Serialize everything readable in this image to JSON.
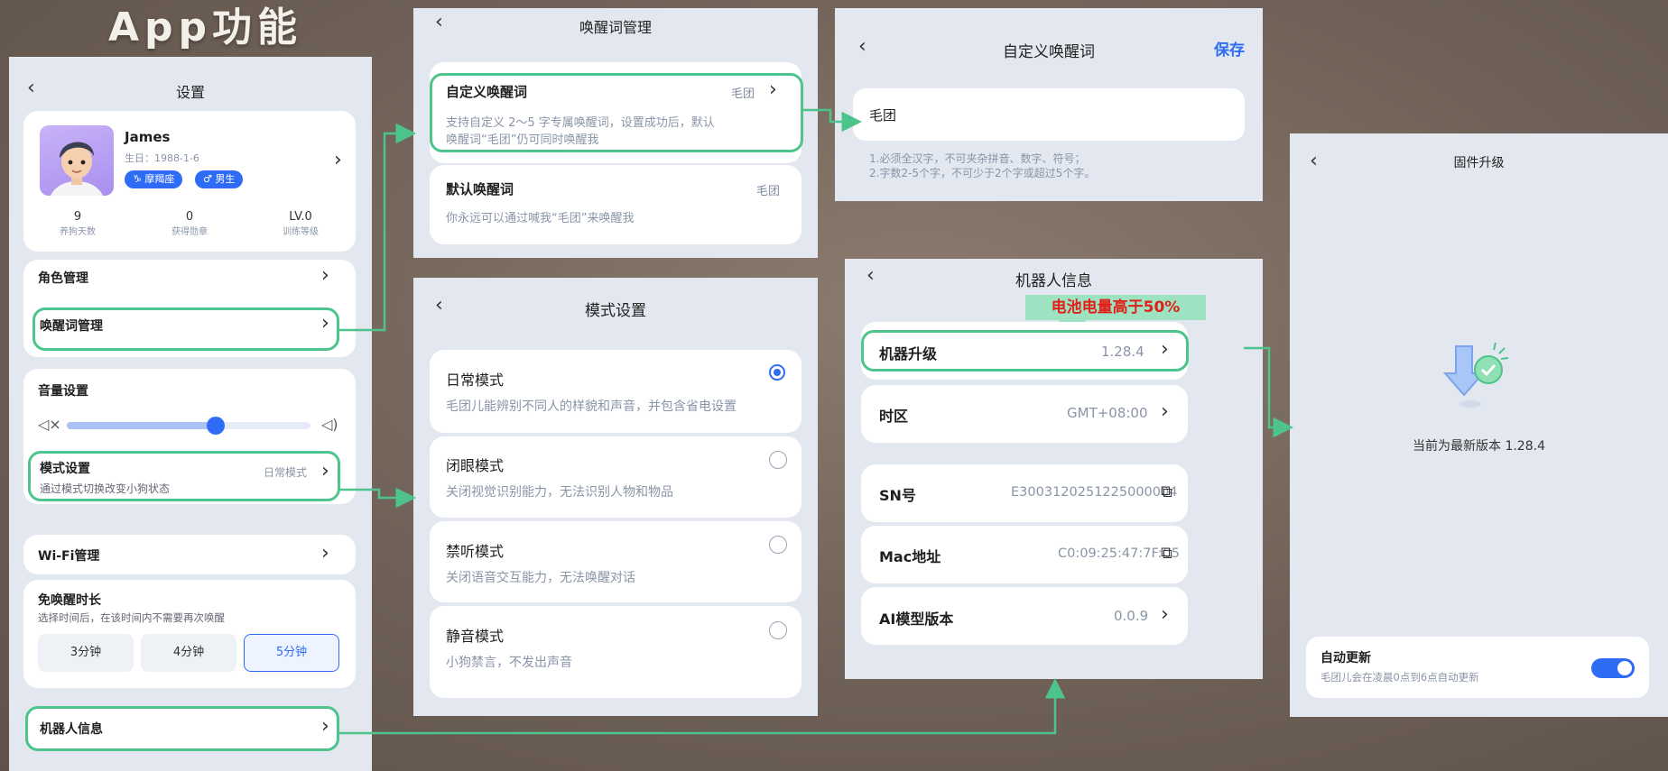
{
  "page_title": "App功能",
  "settings": {
    "title": "设置",
    "profile": {
      "name": "James",
      "birthday": "生日：1988-1-6",
      "zodiac": "摩羯座",
      "gender": "男生",
      "stats": [
        {
          "value": "9",
          "label": "养狗天数"
        },
        {
          "value": "0",
          "label": "获得勋章"
        },
        {
          "value": "LV.0",
          "label": "训练等级"
        }
      ]
    },
    "role": "角色管理",
    "wake_word": "唤醒词管理",
    "volume": "音量设置",
    "volume_level": 0.61,
    "mode": {
      "title": "模式设置",
      "value": "日常模式",
      "desc": "通过模式切换改变小狗状态"
    },
    "wifi": "Wi-Fi管理",
    "nowake": {
      "title": "免唤醒时长",
      "desc": "选择时间后，在该时间内不需要再次唤醒",
      "options": [
        "3分钟",
        "4分钟",
        "5分钟"
      ],
      "selected": "5分钟"
    },
    "robot_info": "机器人信息"
  },
  "wake_panel": {
    "title": "唤醒词管理",
    "custom": {
      "title": "自定义唤醒词",
      "value": "毛团",
      "desc1": "支持自定义 2～5 字专属唤醒词，设置成功后，默认",
      "desc2": "唤醒词“毛团”仍可同时唤醒我"
    },
    "default": {
      "title": "默认唤醒词",
      "value": "毛团",
      "desc": "你永远可以通过喊我“毛团”来唤醒我"
    }
  },
  "custom_panel": {
    "title": "自定义唤醒词",
    "save": "保存",
    "input_value": "毛团",
    "rule1": "1.必须全汉字，不可夹杂拼音、数字、符号；",
    "rule2": "2.字数2-5个字，不可少于2个字或超过5个字。"
  },
  "mode_panel": {
    "title": "模式设置",
    "modes": [
      {
        "name": "日常模式",
        "desc": "毛团儿能辨别不同人的样貌和声音，并包含省电设置",
        "selected": true
      },
      {
        "name": "闭眼模式",
        "desc": "关闭视觉识别能力，无法识别人物和物品",
        "selected": false
      },
      {
        "name": "禁听模式",
        "desc": "关闭语音交互能力，无法唤醒对话",
        "selected": false
      },
      {
        "name": "静音模式",
        "desc": "小狗禁言，不发出声音",
        "selected": false
      }
    ]
  },
  "robot_panel": {
    "title": "机器人信息",
    "callout": "电池电量高于50%",
    "upgrade": {
      "label": "机器升级",
      "value": "1.28.4"
    },
    "timezone": {
      "label": "时区",
      "value": "GMT+08:00"
    },
    "sn": {
      "label": "SN号",
      "value": "E3003120251225000004"
    },
    "mac": {
      "label": "Mac地址",
      "value": "C0:09:25:47:7F:C5"
    },
    "ai": {
      "label": "AI模型版本",
      "value": "0.0.9"
    }
  },
  "firmware_panel": {
    "title": "固件升级",
    "status": "当前为最新版本 1.28.4",
    "auto": {
      "title": "自动更新",
      "desc": "毛团儿会在凌晨0点到6点自动更新",
      "enabled": true
    }
  },
  "colors": {
    "accent": "#2f6cf6",
    "highlight": "#4dc48b",
    "callout_bg": "#9ee3c1",
    "callout_text": "#e0201b"
  }
}
